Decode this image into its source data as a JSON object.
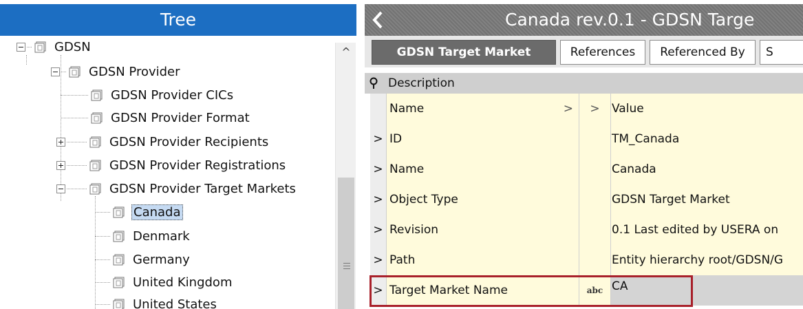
{
  "tree": {
    "header": "Tree",
    "nodes": [
      {
        "label": "GDSN",
        "expander": "minus"
      },
      {
        "label": "GDSN Provider",
        "expander": "minus"
      },
      {
        "label": "GDSN Provider CICs",
        "expander": "none"
      },
      {
        "label": "GDSN Provider Format",
        "expander": "none"
      },
      {
        "label": "GDSN Provider Recipients",
        "expander": "plus"
      },
      {
        "label": "GDSN Provider Registrations",
        "expander": "plus"
      },
      {
        "label": "GDSN Provider Target Markets",
        "expander": "minus"
      },
      {
        "label": "Canada",
        "expander": "none",
        "selected": true
      },
      {
        "label": "Denmark",
        "expander": "none"
      },
      {
        "label": "Germany",
        "expander": "none"
      },
      {
        "label": "United Kingdom",
        "expander": "none"
      },
      {
        "label": "United States",
        "expander": "none"
      }
    ],
    "scroll_up": "^",
    "scroll_grip": "≡"
  },
  "detail": {
    "back_symbol": "<",
    "title": "Canada rev.0.1 - GDSN Targe",
    "tabs": [
      {
        "label": "GDSN Target Market",
        "active": true
      },
      {
        "label": "References"
      },
      {
        "label": "Referenced By"
      },
      {
        "label": "S"
      }
    ],
    "group": "Description",
    "columns": {
      "name": "Name",
      "value": "Value",
      "chevron": ">"
    },
    "rows": [
      {
        "expander": ">",
        "name": "ID",
        "type": "",
        "value": "TM_Canada"
      },
      {
        "expander": ">",
        "name": "Name",
        "type": "",
        "value": "Canada"
      },
      {
        "expander": ">",
        "name": "Object Type",
        "type": "",
        "value": "GDSN Target Market"
      },
      {
        "expander": ">",
        "name": "Revision",
        "type": "",
        "value": "0.1 Last edited by USERA on"
      },
      {
        "expander": ">",
        "name": "Path",
        "type": "",
        "value": "Entity hierarchy root/GDSN/G"
      },
      {
        "expander": ">",
        "name": "Target Market Name",
        "type": "abc",
        "value": "CA",
        "editing": true
      }
    ]
  },
  "colors": {
    "tree_header_bg": "#1c6ec2",
    "title_bar_bg": "#7a7a7a",
    "grid_cell_bg": "#fffbdc",
    "highlight_border": "#a8202a",
    "selection_bg": "#c5daf2"
  }
}
